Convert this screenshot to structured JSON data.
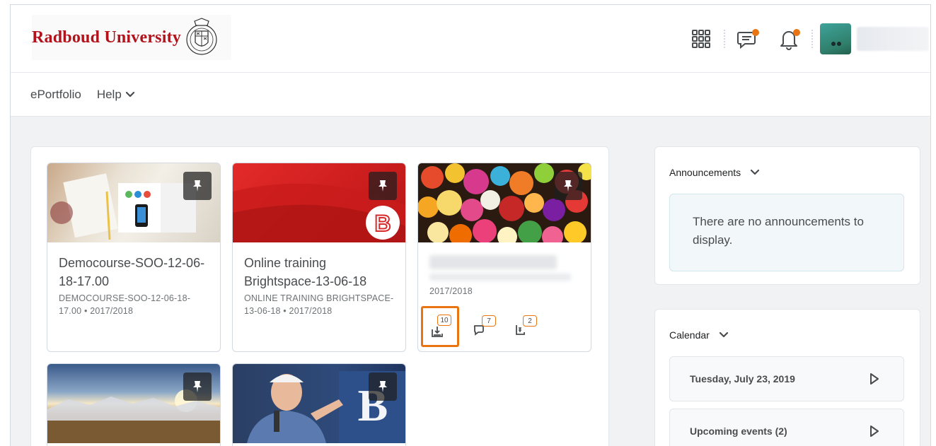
{
  "header": {
    "logo_text": "Radboud University",
    "icons": [
      "apps-grid-icon",
      "message-alert-icon",
      "bell-alert-icon"
    ],
    "accent_color": "#e87511",
    "brand_color": "#b1121b"
  },
  "nav": {
    "items": [
      {
        "label": "ePortfolio"
      },
      {
        "label": "Help"
      }
    ]
  },
  "courses": [
    {
      "title": "Democourse-SOO-12-06-18-17.00",
      "code": "DEMOCOURSE-SOO-12-06-18-17.00 • 2017/2018"
    },
    {
      "title": "Online training Brightspace-13-06-18",
      "code": "ONLINE TRAINING BRIGHTSPACE-13-06-18 • 2017/2018"
    },
    {
      "code": "2017/2018",
      "badges": {
        "assignments": "10",
        "discussions": "7",
        "quizzes": "2"
      }
    }
  ],
  "announcements": {
    "title": "Announcements",
    "empty_message": "There are no announcements to display."
  },
  "calendar": {
    "title": "Calendar",
    "items": [
      {
        "label": "Tuesday, July 23, 2019"
      },
      {
        "label": "Upcoming events (2)"
      }
    ]
  }
}
